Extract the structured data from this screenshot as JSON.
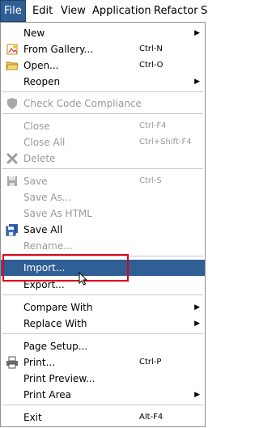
{
  "menubar": {
    "file": "File",
    "edit": "Edit",
    "view": "View",
    "application": "Application",
    "refactor": "Refactor",
    "s": "S"
  },
  "menu": {
    "new": "New",
    "from_gallery": "From Gallery...",
    "from_gallery_shortcut": "Ctrl-N",
    "open": "Open...",
    "open_shortcut": "Ctrl-O",
    "reopen": "Reopen",
    "check_code_compliance": "Check Code Compliance",
    "close": "Close",
    "close_shortcut": "Ctrl-F4",
    "close_all": "Close All",
    "close_all_shortcut": "Ctrl+Shift-F4",
    "delete": "Delete",
    "save": "Save",
    "save_shortcut": "Ctrl-S",
    "save_as": "Save As...",
    "save_as_html": "Save As HTML",
    "save_all": "Save All",
    "rename": "Rename...",
    "import": "Import...",
    "export": "Export...",
    "compare_with": "Compare With",
    "replace_with": "Replace With",
    "page_setup": "Page Setup...",
    "print": "Print...",
    "print_shortcut": "Ctrl-P",
    "print_preview": "Print Preview...",
    "print_area": "Print Area",
    "exit": "Exit",
    "exit_shortcut": "Alt-F4"
  },
  "icons": {
    "submenu": "chevron-right",
    "from_gallery": "gallery-icon",
    "open": "folder-icon",
    "check": "shield-icon",
    "delete": "x-icon",
    "save": "floppy-icon",
    "save_all": "floppy-stack-icon",
    "print": "printer-icon",
    "cursor": "mouse-pointer"
  },
  "colors": {
    "highlight": "#2f5f95",
    "disabled_text": "#9a9a9a",
    "annotation_box": "#e0001b"
  }
}
